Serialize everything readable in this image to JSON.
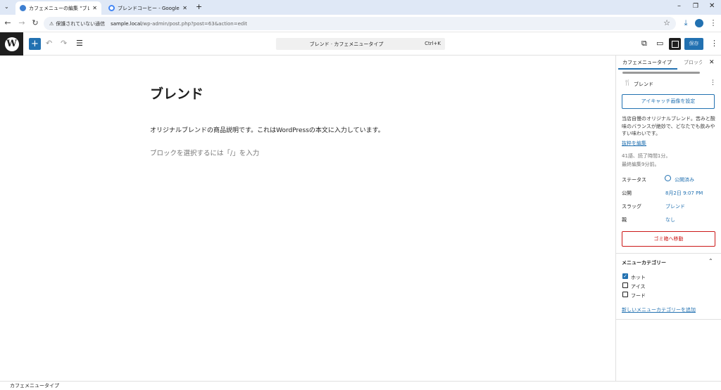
{
  "browser": {
    "tabs": [
      {
        "title": "カフェメニューの編集 \"ブレンド\" - サ:",
        "active": true
      },
      {
        "title": "ブレンドコーヒー - Google 検索",
        "active": false
      }
    ],
    "security_label": "保護されていない通信",
    "url_host": "sample.local",
    "url_path": "/wp-admin/post.php?post=63&action=edit"
  },
  "editor": {
    "command_title": "ブレンド · カフェメニュータイプ",
    "command_shortcut": "Ctrl+K",
    "save_label": "保存"
  },
  "content": {
    "title": "ブレンド",
    "paragraph": "オリジナルブレンドの商品説明です。これはWordPressの本文に入力しています。",
    "placeholder": "ブロックを選択するには「/」を入力"
  },
  "sidebar": {
    "tab_post": "カフェメニュータイプ",
    "tab_block": "ブロック",
    "post_name": "ブレンド",
    "featured_image_button": "アイキャッチ画像を設定",
    "excerpt": "当店自慢のオリジナルブレンド。苦みと酸味のバランスが絶妙で、どなたでも飲みやすい味わいです。",
    "excerpt_edit": "抜粋を編集",
    "word_count": "41語、読了時間1分。",
    "last_edited": "最終編集9分前。",
    "meta": [
      {
        "label": "ステータス",
        "value": "公開済み"
      },
      {
        "label": "公開",
        "value": "8月2日 9:07 PM"
      },
      {
        "label": "スラッグ",
        "value": "ブレンド"
      },
      {
        "label": "親",
        "value": "なし"
      }
    ],
    "trash_button": "ゴミ箱へ移動",
    "category_heading": "メニューカテゴリー",
    "categories": [
      {
        "label": "ホット",
        "checked": true
      },
      {
        "label": "アイス",
        "checked": false
      },
      {
        "label": "フード",
        "checked": false
      }
    ],
    "add_category": "新しいメニューカテゴリーを追加"
  },
  "footer": {
    "breadcrumb": "カフェメニュータイプ"
  },
  "colors": {
    "accent": "#2271b1",
    "danger": "#cc1818"
  }
}
